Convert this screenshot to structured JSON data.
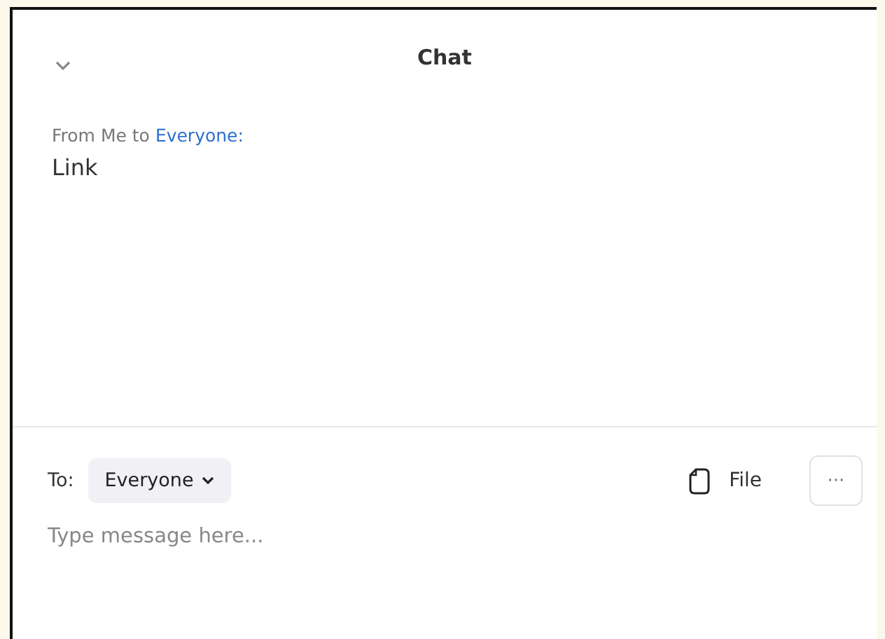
{
  "header": {
    "title": "Chat"
  },
  "messages": [
    {
      "sender_prefix": "From Me to",
      "recipient": "Everyone:",
      "text": "Link"
    }
  ],
  "composer": {
    "to_label": "To:",
    "recipient": "Everyone",
    "file_label": "File",
    "more_label": "···",
    "placeholder": "Type message here..."
  }
}
